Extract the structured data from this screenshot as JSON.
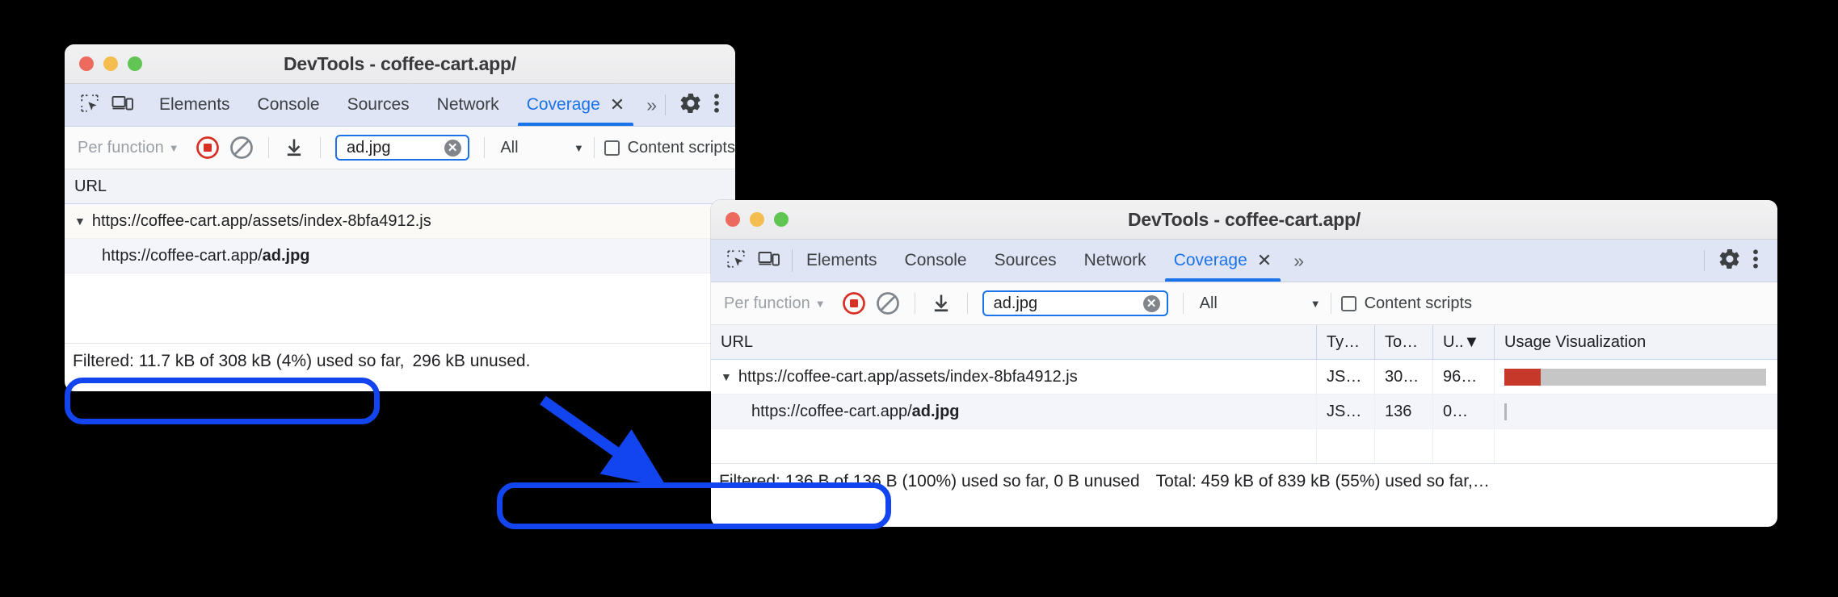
{
  "theme": {
    "accent": "#1a73e8",
    "annotation": "#1245f0",
    "usage_used": "#c5382a",
    "usage_unused": "#c6c6c6",
    "tabstrip_bg": "#dfe5f5"
  },
  "window1": {
    "title": "DevTools - coffee-cart.app/",
    "traffic_lights": [
      "close",
      "minimize",
      "maximize"
    ],
    "tool_icons": [
      "inspect-element-icon",
      "device-toolbar-icon"
    ],
    "tabs": [
      {
        "label": "Elements",
        "active": false
      },
      {
        "label": "Console",
        "active": false
      },
      {
        "label": "Sources",
        "active": false
      },
      {
        "label": "Network",
        "active": false
      },
      {
        "label": "Coverage",
        "active": true,
        "closable": true
      }
    ],
    "more_tabs_label": "»",
    "right_icons": [
      "gear-icon",
      "kebab-menu-icon"
    ],
    "toolbar": {
      "granularity_label": "Per function",
      "record_icon": "record-stop-icon",
      "clear_icon": "clear-icon",
      "export_icon": "download-icon",
      "filter_value": "ad.jpg",
      "filter_placeholder": "Filter",
      "clear_filter_icon": "clear-input-icon",
      "type_filter_value": "All",
      "content_scripts_label": "Content scripts",
      "content_scripts_checked": false
    },
    "grid": {
      "columns": [
        "URL"
      ],
      "rows": [
        {
          "url_prefix": "https://coffee-cart.app/assets/index-8bfa4912.js",
          "url_bold": "",
          "expandable": true,
          "indent": 0
        },
        {
          "url_prefix": "https://coffee-cart.app/",
          "url_bold": "ad.jpg",
          "expandable": false,
          "indent": 1
        }
      ]
    },
    "status": {
      "filtered": "Filtered: 11.7 kB of 308 kB (4%) used so far,",
      "filtered_tail": "296 kB unused."
    }
  },
  "window2": {
    "title": "DevTools - coffee-cart.app/",
    "traffic_lights": [
      "close",
      "minimize",
      "maximize"
    ],
    "tool_icons": [
      "inspect-element-icon",
      "device-toolbar-icon"
    ],
    "tabs": [
      {
        "label": "Elements",
        "active": false
      },
      {
        "label": "Console",
        "active": false
      },
      {
        "label": "Sources",
        "active": false
      },
      {
        "label": "Network",
        "active": false
      },
      {
        "label": "Coverage",
        "active": true,
        "closable": true
      }
    ],
    "more_tabs_label": "»",
    "right_icons": [
      "gear-icon",
      "kebab-menu-icon"
    ],
    "toolbar": {
      "granularity_label": "Per function",
      "record_icon": "record-stop-icon",
      "clear_icon": "clear-icon",
      "export_icon": "download-icon",
      "filter_value": "ad.jpg",
      "filter_placeholder": "Filter",
      "clear_filter_icon": "clear-input-icon",
      "type_filter_value": "All",
      "content_scripts_label": "Content scripts",
      "content_scripts_checked": false
    },
    "grid": {
      "columns": [
        "URL",
        "Ty…",
        "To…",
        "U..▼",
        "Usage Visualization"
      ],
      "rows": [
        {
          "url_prefix": "https://coffee-cart.app/assets/index-8bfa4912.js",
          "url_bold": "",
          "type": "JS…",
          "total": "30…",
          "unused": "96…",
          "expandable": true,
          "indent": 0,
          "usage_used_pct": 14,
          "usage_total_pct": 100
        },
        {
          "url_prefix": "https://coffee-cart.app/",
          "url_bold": "ad.jpg",
          "type": "JS…",
          "total": "136",
          "unused": "0…",
          "expandable": false,
          "indent": 1,
          "usage_used_pct": 0,
          "usage_total_pct": 0
        }
      ]
    },
    "status": {
      "filtered": "Filtered: 136 B of 136 B (100%) used so far, 0 B unused",
      "total": "Total: 459 kB of 839 kB (55%) used so far,…"
    }
  },
  "annotations": {
    "callout1_target": "window1-filtered-status",
    "callout2_target": "window2-filtered-status",
    "arrow": "points from window1 filtered status to window2 filtered status"
  }
}
